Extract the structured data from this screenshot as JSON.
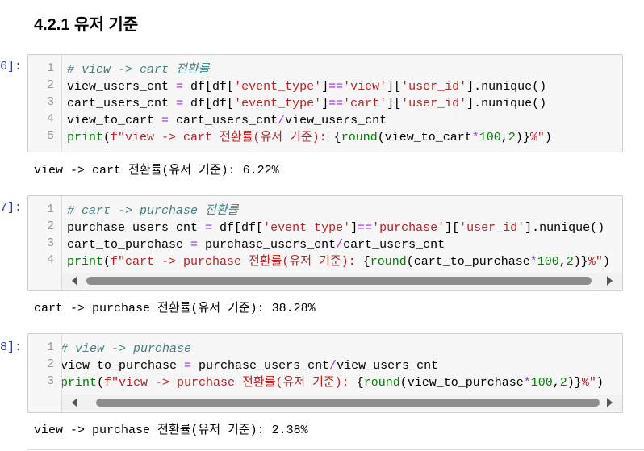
{
  "heading": "4.2.1  유저 기준",
  "cells": [
    {
      "prompt": "6]:",
      "lines": [
        [
          [
            "# view -> cart 전환률",
            "c"
          ]
        ],
        [
          [
            "view_users_cnt ",
            "t"
          ],
          [
            "=",
            "o"
          ],
          [
            " df[df[",
            "t"
          ],
          [
            "'event_type'",
            "s"
          ],
          [
            "]",
            "t"
          ],
          [
            "==",
            "o"
          ],
          [
            "'view'",
            "s"
          ],
          [
            "][",
            "t"
          ],
          [
            "'user_id'",
            "s"
          ],
          [
            "].nunique()",
            "t"
          ]
        ],
        [
          [
            "cart_users_cnt ",
            "t"
          ],
          [
            "=",
            "o"
          ],
          [
            " df[df[",
            "t"
          ],
          [
            "'event_type'",
            "s"
          ],
          [
            "]",
            "t"
          ],
          [
            "==",
            "o"
          ],
          [
            "'cart'",
            "s"
          ],
          [
            "][",
            "t"
          ],
          [
            "'user_id'",
            "s"
          ],
          [
            "].nunique()",
            "t"
          ]
        ],
        [
          [
            "view_to_cart ",
            "t"
          ],
          [
            "=",
            "o"
          ],
          [
            " cart_users_cnt",
            "t"
          ],
          [
            "/",
            "o"
          ],
          [
            "view_users_cnt",
            "t"
          ]
        ],
        [
          [
            "print",
            "b"
          ],
          [
            "(",
            "t"
          ],
          [
            "f\"view -> cart 전환률(유저 기준): ",
            "s"
          ],
          [
            "{",
            "t"
          ],
          [
            "round",
            "b"
          ],
          [
            "(view_to_cart",
            "t"
          ],
          [
            "*",
            "o"
          ],
          [
            "100",
            "n"
          ],
          [
            ",",
            "t"
          ],
          [
            "2",
            "n"
          ],
          [
            ")}",
            "t"
          ],
          [
            "%\"",
            "s"
          ],
          [
            ")",
            "t"
          ]
        ]
      ],
      "output": "view -> cart 전환률(유저 기준): 6.22%"
    },
    {
      "prompt": "7]:",
      "lines": [
        [
          [
            "# cart -> purchase 전환률",
            "c"
          ]
        ],
        [
          [
            "purchase_users_cnt ",
            "t"
          ],
          [
            "=",
            "o"
          ],
          [
            " df[df[",
            "t"
          ],
          [
            "'event_type'",
            "s"
          ],
          [
            "]",
            "t"
          ],
          [
            "==",
            "o"
          ],
          [
            "'purchase'",
            "s"
          ],
          [
            "][",
            "t"
          ],
          [
            "'user_id'",
            "s"
          ],
          [
            "].nunique()",
            "t"
          ]
        ],
        [
          [
            "cart_to_purchase ",
            "t"
          ],
          [
            "=",
            "o"
          ],
          [
            " purchase_users_cnt",
            "t"
          ],
          [
            "/",
            "o"
          ],
          [
            "cart_users_cnt",
            "t"
          ]
        ],
        [
          [
            "print",
            "b"
          ],
          [
            "(",
            "t"
          ],
          [
            "f\"cart -> purchase 전환률(유저 기준): ",
            "s"
          ],
          [
            "{",
            "t"
          ],
          [
            "round",
            "b"
          ],
          [
            "(cart_to_purchase",
            "t"
          ],
          [
            "*",
            "o"
          ],
          [
            "100",
            "n"
          ],
          [
            ",",
            "t"
          ],
          [
            "2",
            "n"
          ],
          [
            ")}",
            "t"
          ],
          [
            "%\"",
            "s"
          ],
          [
            ")",
            "t"
          ]
        ]
      ],
      "output": "cart -> purchase 전환률(유저 기준): 38.28%"
    },
    {
      "prompt": "8]:",
      "lines": [
        [
          [
            "# view -> purchase",
            "c"
          ]
        ],
        [
          [
            "view_to_purchase ",
            "t"
          ],
          [
            "=",
            "o"
          ],
          [
            " purchase_users_cnt",
            "t"
          ],
          [
            "/",
            "o"
          ],
          [
            "view_users_cnt",
            "t"
          ]
        ],
        [
          [
            "print",
            "b"
          ],
          [
            "(",
            "t"
          ],
          [
            "f\"view -> purchase 전환률(유저 기준): ",
            "s"
          ],
          [
            "{",
            "t"
          ],
          [
            "round",
            "b"
          ],
          [
            "(view_to_purchase",
            "t"
          ],
          [
            "*",
            "o"
          ],
          [
            "100",
            "n"
          ],
          [
            ",",
            "t"
          ],
          [
            "2",
            "n"
          ],
          [
            ")}",
            "t"
          ],
          [
            "%\"",
            "s"
          ],
          [
            ")",
            "t"
          ]
        ]
      ],
      "output": "view -> purchase 전환률(유저 기준): 2.38%"
    }
  ]
}
